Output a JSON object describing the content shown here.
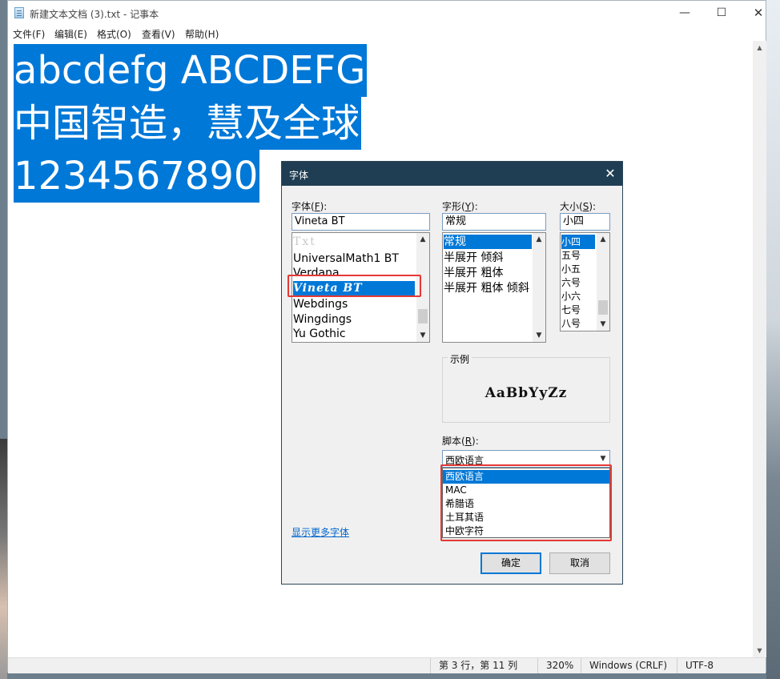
{
  "window": {
    "title": "新建文本文档 (3).txt - 记事本",
    "minimize": "—",
    "maximize": "☐",
    "close": "✕"
  },
  "menu": [
    "文件(F)",
    "编辑(E)",
    "格式(O)",
    "查看(V)",
    "帮助(H)"
  ],
  "editor": {
    "lines": [
      "abcdefg ABCDEFG",
      "中国智造，慧及全球",
      "1234567890"
    ]
  },
  "statusbar": {
    "position": "第 3 行，第 11 列",
    "zoom": "320%",
    "line_ending": "Windows (CRLF)",
    "encoding": "UTF-8"
  },
  "dialog": {
    "title": "字体",
    "close": "✕",
    "font_label": "字体(",
    "font_key": "F",
    "font_label_end": "):",
    "style_label": "字形(",
    "style_key": "Y",
    "style_label_end": "):",
    "size_label": "大小(",
    "size_key": "S",
    "size_label_end": "):",
    "font_value": "Vineta BT",
    "style_value": "常规",
    "size_value": "小四",
    "font_list": [
      "Txt",
      "UniversalMath1 BT",
      "Verdana",
      "Vineta BT",
      "Webdings",
      "Wingdings",
      "Yu Gothic"
    ],
    "font_selected": "Vineta BT",
    "style_list": [
      "常规",
      "半展开 倾斜",
      "半展开 粗体",
      "半展开 粗体 倾斜"
    ],
    "style_selected": "常规",
    "size_list": [
      "小四",
      "五号",
      "小五",
      "六号",
      "小六",
      "七号",
      "八号"
    ],
    "size_selected": "小四",
    "sample_label": "示例",
    "sample_text": "AaBbYyZz",
    "script_label": "脚本(",
    "script_key": "R",
    "script_label_end": "):",
    "script_value": "西欧语言",
    "script_options": [
      "西欧语言",
      "MAC",
      "希腊语",
      "土耳其语",
      "中欧字符"
    ],
    "script_selected": "西欧语言",
    "more_fonts": "显示更多字体",
    "ok": "确定",
    "cancel": "取消"
  },
  "colors": {
    "selection": "#0078d7",
    "dialog_title": "#203e53",
    "highlight_box": "#e53935",
    "link": "#0066cc"
  }
}
